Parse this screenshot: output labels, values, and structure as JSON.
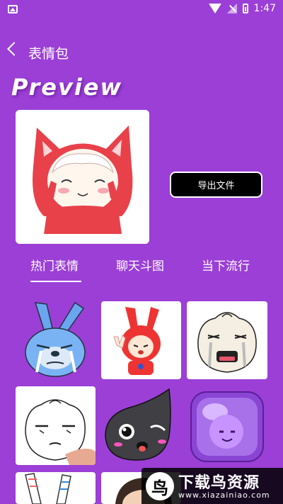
{
  "status_bar": {
    "time": "1:47"
  },
  "header": {
    "title": "表情包"
  },
  "preview": {
    "label": "Preview"
  },
  "export_button": {
    "label": "导出文件"
  },
  "tabs": [
    {
      "label": "热门表情",
      "active": true
    },
    {
      "label": "聊天斗图",
      "active": false
    },
    {
      "label": "当下流行",
      "active": false
    }
  ],
  "stickers": [
    {
      "name": "blue-rabbit-crying"
    },
    {
      "name": "red-bunny-hood-peace"
    },
    {
      "name": "steamed-bun-crying"
    },
    {
      "name": "steamed-bun-pinched-cheek"
    },
    {
      "name": "black-droplet-wink"
    },
    {
      "name": "purple-jelly-cube"
    },
    {
      "name": "white-rabbit-partial"
    },
    {
      "name": "character-partial"
    }
  ],
  "watermark": {
    "title": "下载鸟资源",
    "url": "www.xiazainiao.com",
    "logo": "鸟"
  },
  "colors": {
    "background": "#9b3fd6",
    "button": "#000000",
    "text": "#ffffff"
  }
}
